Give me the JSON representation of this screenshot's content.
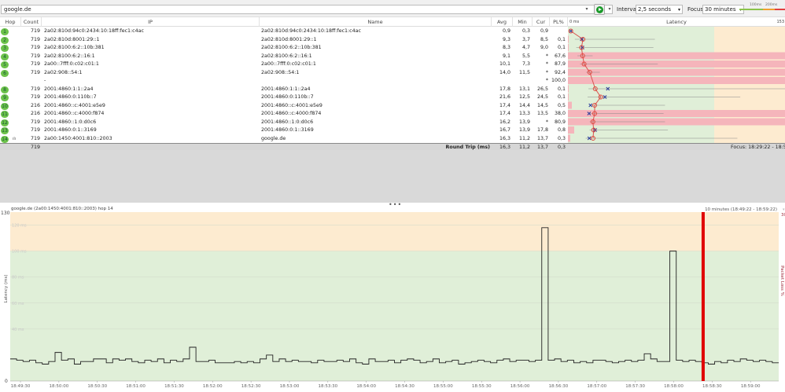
{
  "toolbar": {
    "address": "google.de",
    "interval_label": "Interval",
    "interval_value": "2,5 seconds",
    "focus_label": "Focus",
    "focus_value": "30 minutes",
    "scale_100": "100ms",
    "scale_200": "200ms"
  },
  "columns": {
    "hop": "Hop",
    "count": "Count",
    "ip": "IP",
    "name": "Name",
    "avg": "Avg",
    "min": "Min",
    "cur": "Cur",
    "pl": "PL%",
    "latency_zero": "0 ms",
    "latency": "Latency",
    "latency_max": "153"
  },
  "hops": [
    {
      "hop": "1",
      "count": "719",
      "ip": "2a02:810d:94c0:2434:10:18ff:fec1:c4ac",
      "name": "2a02:810d:94c0:2434:10:18ff:fec1:c4ac",
      "avg": "0,9",
      "min": "0,3",
      "cur": "0,9",
      "pl": "",
      "avg_ms": 0.9,
      "min_ms": 0.3,
      "cur_ms": 0.9,
      "max_ms": 1,
      "pl_pct": 0
    },
    {
      "hop": "2",
      "count": "719",
      "ip": "2a02:810d:8001:29::1",
      "name": "2a02:810d:8001:29::1",
      "avg": "9,3",
      "min": "3,7",
      "cur": "8,5",
      "pl": "0,1",
      "avg_ms": 9.3,
      "min_ms": 3.7,
      "cur_ms": 8.5,
      "max_ms": 59,
      "pl_pct": 0.1
    },
    {
      "hop": "3",
      "count": "719",
      "ip": "2a02:8100:6:2::10b:381",
      "name": "2a02:8100:6:2::10b:381",
      "avg": "8,3",
      "min": "4,7",
      "cur": "9,0",
      "pl": "0,1",
      "avg_ms": 8.3,
      "min_ms": 4.7,
      "cur_ms": 9.0,
      "max_ms": 58,
      "pl_pct": 0.1
    },
    {
      "hop": "4",
      "count": "719",
      "ip": "2a02:8100:6:2::16:1",
      "name": "2a02:8100:6:2::16:1",
      "avg": "9,1",
      "min": "5,5",
      "cur": "*",
      "pl": "67,6",
      "avg_ms": 9.1,
      "min_ms": 5.5,
      "cur_ms": null,
      "max_ms": 16,
      "pl_pct": 67.6
    },
    {
      "hop": "5",
      "count": "719",
      "ip": "2a00::7fff:0:c02:c01:1",
      "name": "2a00::7fff:0:c02:c01:1",
      "avg": "10,1",
      "min": "7,3",
      "cur": "*",
      "pl": "87,9",
      "avg_ms": 10.1,
      "min_ms": 7.3,
      "cur_ms": null,
      "max_ms": 61,
      "pl_pct": 87.9
    },
    {
      "hop": "6",
      "count": "719",
      "ip": "2a02:908::54:1",
      "name": "2a02:908::54:1",
      "avg": "14,0",
      "min": "11,5",
      "cur": "*",
      "pl": "92,4",
      "avg_ms": 14.0,
      "min_ms": 11.5,
      "cur_ms": null,
      "max_ms": 21,
      "pl_pct": 92.4
    },
    {
      "hop": "",
      "count": "",
      "ip": "-",
      "name": "",
      "avg": "",
      "min": "",
      "cur": "*",
      "pl": "100,0",
      "avg_ms": null,
      "min_ms": null,
      "cur_ms": null,
      "max_ms": null,
      "pl_pct": 100
    },
    {
      "hop": "8",
      "count": "719",
      "ip": "2001:4860:1:1::2a4",
      "name": "2001:4860:1:1::2a4",
      "avg": "17,8",
      "min": "13,1",
      "cur": "26,5",
      "pl": "0,1",
      "avg_ms": 17.8,
      "min_ms": 13.1,
      "cur_ms": 26.5,
      "max_ms": 153,
      "pl_pct": 0.1
    },
    {
      "hop": "9",
      "count": "719",
      "ip": "2001:4860:0:110b::7",
      "name": "2001:4860:0:110b::7",
      "avg": "21,6",
      "min": "12,5",
      "cur": "24,5",
      "pl": "0,1",
      "avg_ms": 21.6,
      "min_ms": 12.5,
      "cur_ms": 24.5,
      "max_ms": 118,
      "pl_pct": 0.1
    },
    {
      "hop": "10",
      "count": "216",
      "ip": "2001:4860::c:4001:e5e9",
      "name": "2001:4860::c:4001:e5e9",
      "avg": "17,4",
      "min": "14,4",
      "cur": "14,5",
      "pl": "0,5",
      "avg_ms": 17.4,
      "min_ms": 14.4,
      "cur_ms": 14.5,
      "max_ms": 66,
      "pl_pct": 0.5
    },
    {
      "hop": "11",
      "count": "216",
      "ip": "2001:4860::c:4000:f874",
      "name": "2001:4860::c:4000:f874",
      "avg": "17,4",
      "min": "13,3",
      "cur": "13,5",
      "pl": "38,0",
      "avg_ms": 17.4,
      "min_ms": 13.3,
      "cur_ms": 13.5,
      "max_ms": 65,
      "pl_pct": 38.0
    },
    {
      "hop": "12",
      "count": "719",
      "ip": "2001:4860::1:0:d0c6",
      "name": "2001:4860::1:0:d0c6",
      "avg": "16,2",
      "min": "13,9",
      "cur": "*",
      "pl": "80,9",
      "avg_ms": 16.2,
      "min_ms": 13.9,
      "cur_ms": null,
      "max_ms": 66,
      "pl_pct": 80.9
    },
    {
      "hop": "13",
      "count": "719",
      "ip": "2001:4860:0:1::3169",
      "name": "2001:4860:0:1::3169",
      "avg": "16,7",
      "min": "13,9",
      "cur": "17,8",
      "pl": "0,8",
      "avg_ms": 16.7,
      "min_ms": 13.9,
      "cur_ms": 17.8,
      "max_ms": 68,
      "pl_pct": 0.8
    },
    {
      "hop": "14",
      "count": "719",
      "ip": "2a00:1450:4001:810::2003",
      "name": "google.de",
      "avg": "16,3",
      "min": "11,2",
      "cur": "13,7",
      "pl": "0,3",
      "avg_ms": 16.3,
      "min_ms": 11.2,
      "cur_ms": 13.7,
      "max_ms": 116,
      "pl_pct": 0.3,
      "graph_icon": "bar-chart-icon"
    }
  ],
  "summary": {
    "count": "719",
    "label": "Round Trip (ms)",
    "avg": "16,3",
    "min": "11,2",
    "cur": "13,7",
    "pl": "0,3",
    "focus": "Focus: 18:29:22 - 18:59:22"
  },
  "chart_data": {
    "type": "line",
    "title": "google.de (2a00:1450:4001:810::2003) hop 14",
    "range_label": "10 minutes (18:49:22 - 18:59:22)",
    "ylabel": "Latency (ms)",
    "y2label": "Packet Loss %",
    "ylim": [
      0,
      130
    ],
    "y_tick_labels": [
      "130",
      "0"
    ],
    "y2_tick_label": "30",
    "gridlines": [
      "120 ms",
      "100 ms",
      "80 ms",
      "60 ms",
      "40 ms"
    ],
    "gridline_values": [
      120,
      100,
      80,
      60,
      40
    ],
    "threshold_ms": 100,
    "colors": {
      "good": "#e0efd8",
      "warn": "#fdebd0",
      "line": "#222222",
      "marker": "#e00000"
    },
    "x_start": "18:49:22",
    "x_step_seconds": 5,
    "x_span_seconds": 600,
    "x_ticks": [
      "18:49:30",
      "18:50:00",
      "18:50:30",
      "18:51:00",
      "18:51:30",
      "18:52:00",
      "18:52:30",
      "18:53:00",
      "18:53:30",
      "18:54:00",
      "18:54:30",
      "18:55:00",
      "18:55:30",
      "18:56:00",
      "18:56:30",
      "18:57:00",
      "18:57:30",
      "18:58:00",
      "18:58:30",
      "18:59:00"
    ],
    "marker_time": "18:58:23",
    "values": [
      17,
      16,
      15,
      16,
      14,
      13,
      15,
      22,
      16,
      17,
      13,
      15,
      15,
      17,
      17,
      14,
      17,
      16,
      17,
      15,
      14,
      16,
      15,
      17,
      14,
      16,
      15,
      17,
      26,
      15,
      15,
      16,
      14,
      14,
      14,
      15,
      14,
      15,
      14,
      17,
      20,
      15,
      17,
      15,
      16,
      15,
      15,
      14,
      16,
      15,
      15,
      16,
      15,
      17,
      14,
      13,
      17,
      15,
      15,
      16,
      14,
      16,
      17,
      16,
      14,
      15,
      17,
      14,
      15,
      16,
      13,
      14,
      15,
      16,
      15,
      14,
      16,
      17,
      15,
      16,
      16,
      15,
      16,
      118,
      16,
      17,
      15,
      16,
      14,
      15,
      14,
      16,
      16,
      15,
      14,
      15,
      16,
      15,
      16,
      21,
      17,
      15,
      15,
      100,
      16,
      15,
      16,
      15,
      14,
      13,
      15,
      14,
      16,
      15,
      17,
      16,
      15,
      16,
      15,
      14
    ]
  }
}
